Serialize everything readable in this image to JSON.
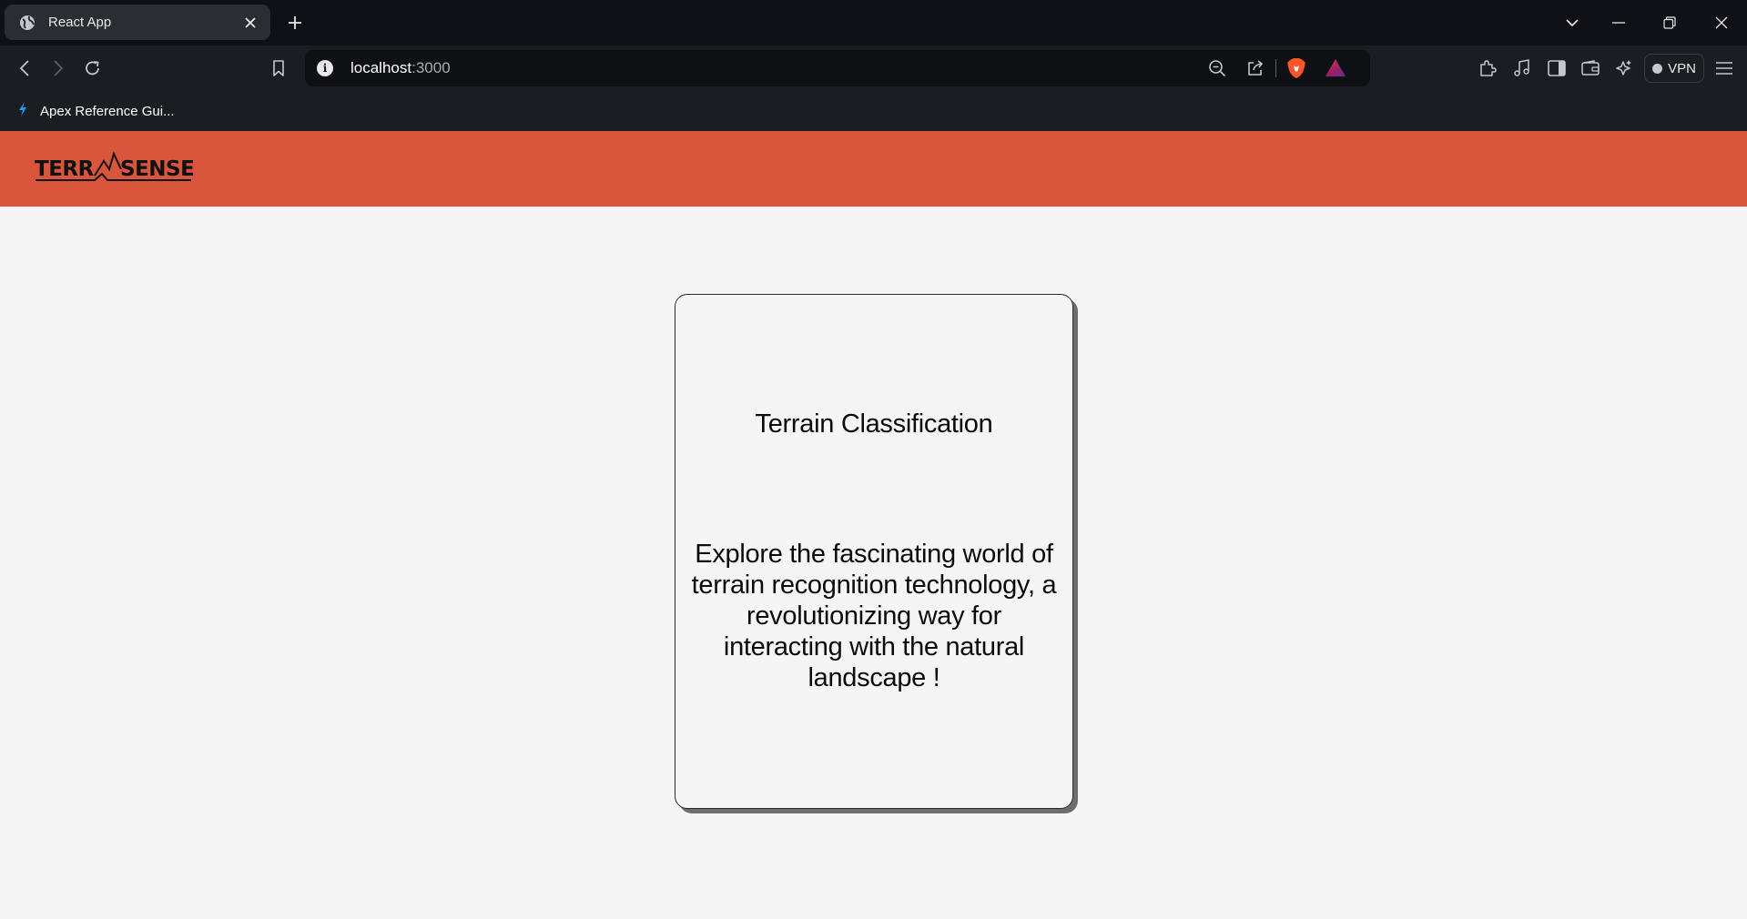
{
  "browser": {
    "tab": {
      "title": "React App",
      "favicon": "globe-icon"
    },
    "address": {
      "host": "localhost",
      "port": ":3000"
    },
    "bookmarks": [
      {
        "label": "Apex Reference Gui...",
        "icon": "lightning-icon"
      }
    ],
    "vpn_label": "VPN",
    "colors": {
      "tabstrip": "#0f1117",
      "toolbar": "#1c1d22",
      "tab_active": "#2b2d33"
    }
  },
  "header": {
    "logo": {
      "left": "TERR",
      "right": "SENSE"
    },
    "bg_color": "#d9553c"
  },
  "card": {
    "title": "Terrain Classification",
    "body": "Explore the fascinating world of terrain recognition technology, a revolutionizing way for interacting with the natural landscape !"
  }
}
